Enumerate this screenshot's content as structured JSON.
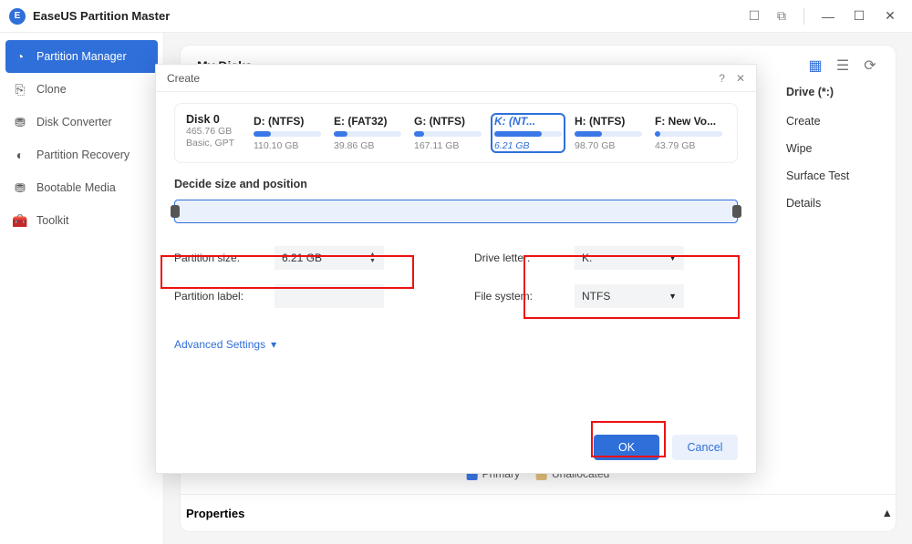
{
  "app": {
    "title": "EaseUS Partition Master"
  },
  "sysicons": {
    "a": "☐",
    "b": "⧉",
    "min": "—",
    "max": "☐",
    "close": "✕"
  },
  "sidebar": {
    "items": [
      {
        "label": "Partition Manager",
        "icon": "◔"
      },
      {
        "label": "Clone",
        "icon": "⎘"
      },
      {
        "label": "Disk Converter",
        "icon": "⛃"
      },
      {
        "label": "Partition Recovery",
        "icon": "◐"
      },
      {
        "label": "Bootable Media",
        "icon": "⛃"
      },
      {
        "label": "Toolkit",
        "icon": "🧰"
      }
    ]
  },
  "panel": {
    "title": "My Disks",
    "tools": {
      "grid": "▦",
      "list": "☰",
      "refresh": "⟳"
    }
  },
  "peek": {
    "drive": "Drive (*:)",
    "items": [
      "Create",
      "Wipe",
      "Surface Test",
      "Details"
    ]
  },
  "legend": {
    "primary": "Primary",
    "unallocated": "Unallocated"
  },
  "properties": {
    "label": "Properties",
    "caret": "▴"
  },
  "modal": {
    "title": "Create",
    "help": "?",
    "close": "✕",
    "disk": {
      "name": "Disk 0",
      "size": "465.76 GB",
      "type": "Basic, GPT"
    },
    "parts": [
      {
        "name": "D: (NTFS)",
        "size": "110.10 GB",
        "fill": 25
      },
      {
        "name": "E: (FAT32)",
        "size": "39.86 GB",
        "fill": 20
      },
      {
        "name": "G: (NTFS)",
        "size": "167.11 GB",
        "fill": 15
      },
      {
        "name": "K: (NT...",
        "size": "6.21 GB",
        "fill": 70,
        "selected": true
      },
      {
        "name": "H: (NTFS)",
        "size": "98.70 GB",
        "fill": 40
      },
      {
        "name": "F: New Vo...",
        "size": "43.79 GB",
        "fill": 8
      }
    ],
    "decide": "Decide size and position",
    "fields": {
      "size_label": "Partition size:",
      "size_value": "6.21 GB",
      "label_label": "Partition label:",
      "label_value": "",
      "letter_label": "Drive letter:",
      "letter_value": "K:",
      "fs_label": "File system:",
      "fs_value": "NTFS"
    },
    "advanced": "Advanced Settings",
    "adv_caret": "▾",
    "ok": "OK",
    "cancel": "Cancel"
  }
}
